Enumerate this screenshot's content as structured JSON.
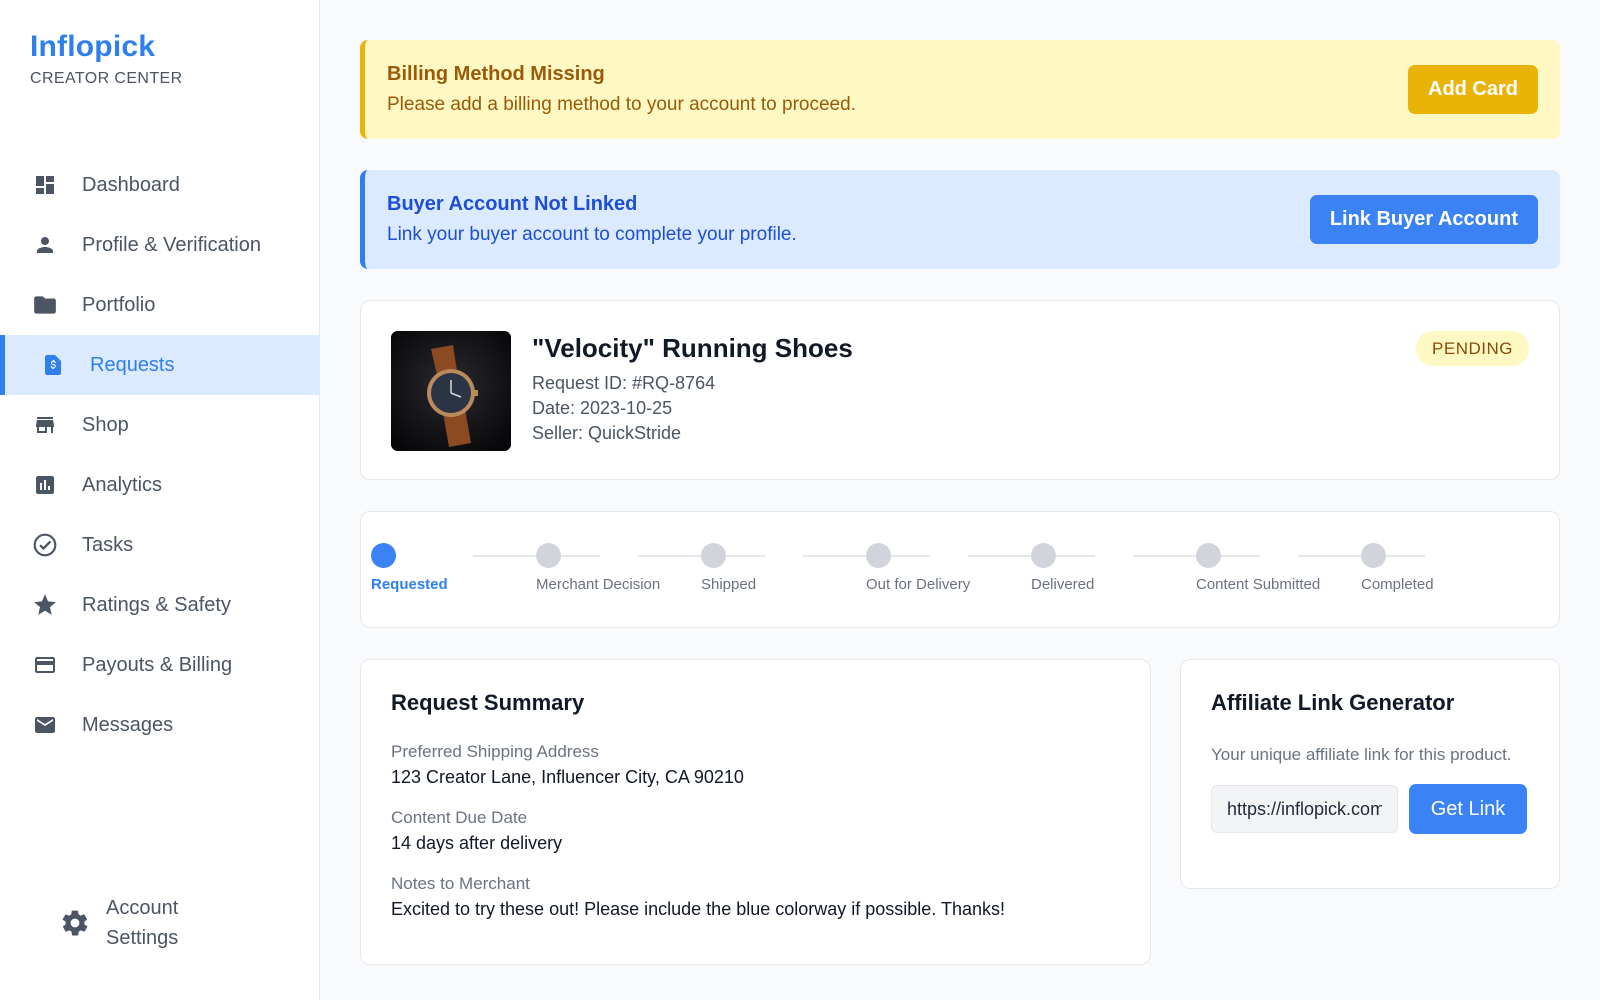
{
  "brand": {
    "name": "Inflopick",
    "subtitle": "CREATOR CENTER"
  },
  "sidebar": {
    "items": [
      {
        "label": "Dashboard",
        "icon": "dashboard-icon"
      },
      {
        "label": "Profile & Verification",
        "icon": "person-icon"
      },
      {
        "label": "Portfolio",
        "icon": "folder-icon"
      },
      {
        "label": "Requests",
        "icon": "request-document-icon",
        "active": true
      },
      {
        "label": "Shop",
        "icon": "store-icon"
      },
      {
        "label": "Analytics",
        "icon": "bar-chart-icon"
      },
      {
        "label": "Tasks",
        "icon": "check-circle-icon"
      },
      {
        "label": "Ratings & Safety",
        "icon": "star-icon"
      },
      {
        "label": "Payouts & Billing",
        "icon": "credit-card-icon"
      },
      {
        "label": "Messages",
        "icon": "mail-icon"
      }
    ],
    "settings_label": "Account Settings"
  },
  "alerts": {
    "billing": {
      "title": "Billing Method Missing",
      "message": "Please add a billing method to your account to proceed.",
      "button": "Add Card"
    },
    "buyer": {
      "title": "Buyer Account Not Linked",
      "message": "Link your buyer account to complete your profile.",
      "button": "Link Buyer Account"
    }
  },
  "request": {
    "title": "\"Velocity\" Running Shoes",
    "request_id": "Request ID: #RQ-8764",
    "date": "Date: 2023-10-25",
    "seller": "Seller: QuickStride",
    "status": "PENDING"
  },
  "progress": {
    "steps": [
      "Requested",
      "Merchant Decision",
      "Shipped",
      "Out for Delivery",
      "Delivered",
      "Content Submitted",
      "Completed"
    ],
    "current_index": 0
  },
  "summary": {
    "title": "Request Summary",
    "shipping_label": "Preferred Shipping Address",
    "shipping_value": "123 Creator Lane, Influencer City, CA 90210",
    "due_label": "Content Due Date",
    "due_value": "14 days after delivery",
    "notes_label": "Notes to Merchant",
    "notes_value": "Excited to try these out! Please include the blue colorway if possible. Thanks!"
  },
  "affiliate": {
    "title": "Affiliate Link Generator",
    "description": "Your unique affiliate link for this product.",
    "link_value": "https://inflopick.com",
    "button": "Get Link"
  },
  "colors": {
    "accent": "#2f80ed",
    "warning": "#eab308",
    "warning_bg": "#fef9c3",
    "info_bg": "#dbeafe"
  }
}
